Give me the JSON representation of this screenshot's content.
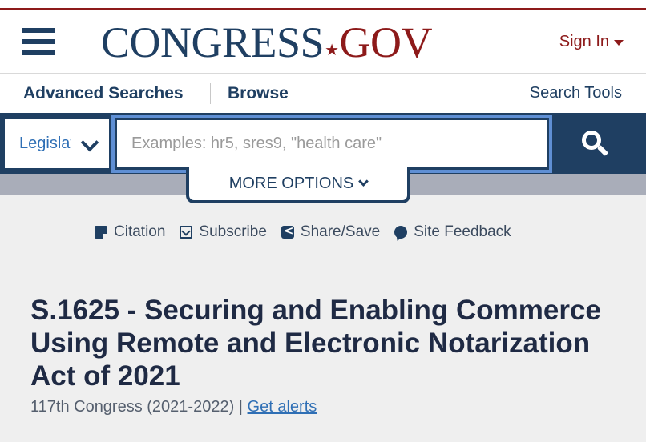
{
  "header": {
    "logo_congress": "CONGRESS",
    "logo_dot": "★",
    "logo_gov": "GOV",
    "sign_in": "Sign In"
  },
  "nav": {
    "advanced_searches": "Advanced Searches",
    "browse": "Browse",
    "search_tools": "Search Tools"
  },
  "search": {
    "scope_label": "Legislation",
    "placeholder": "Examples: hr5, sres9, \"health care\"",
    "more_options": "MORE OPTIONS"
  },
  "actions": {
    "citation": "Citation",
    "subscribe": "Subscribe",
    "share_save": "Share/Save",
    "site_feedback": "Site Feedback"
  },
  "bill": {
    "title": "S.1625 - Securing and Enabling Commerce Using Remote and Electronic Notarization Act of 2021",
    "congress": "117th Congress (2021-2022) | ",
    "get_alerts": "Get alerts"
  },
  "colors": {
    "brand_navy": "#1f3f62",
    "brand_red": "#8d1a1a",
    "link_blue": "#2f6fb5",
    "focus_blue": "#5f8fd4"
  },
  "icons": [
    "menu-icon",
    "chevron-down-icon",
    "search-icon",
    "citation-icon",
    "subscribe-icon",
    "share-icon",
    "feedback-icon"
  ]
}
